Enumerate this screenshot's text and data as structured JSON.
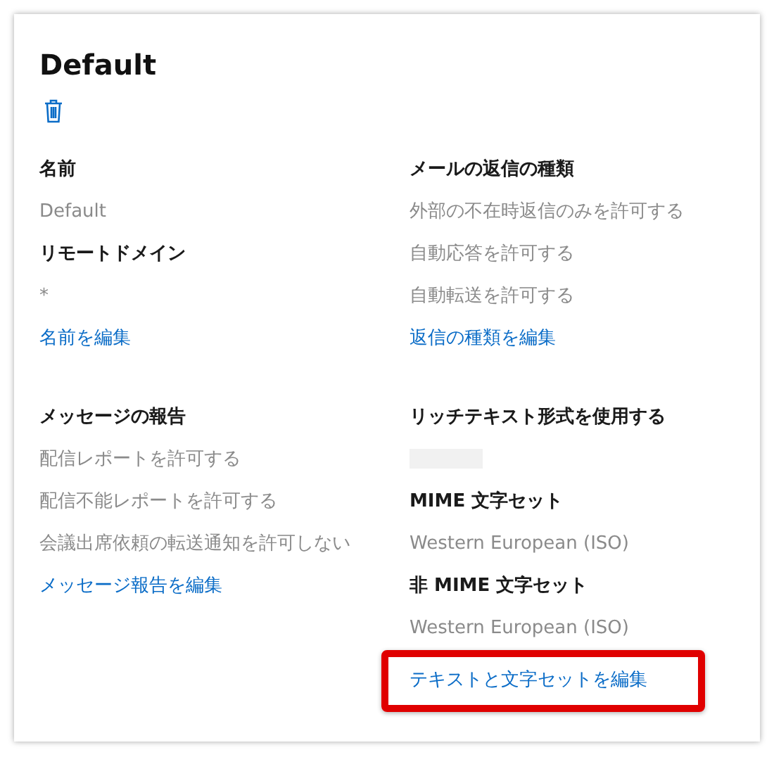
{
  "title": "Default",
  "sections": [
    {
      "columns": [
        {
          "items": [
            {
              "kind": "heading",
              "text": "名前"
            },
            {
              "kind": "value",
              "text": "Default"
            },
            {
              "kind": "heading",
              "text": "リモートドメイン"
            },
            {
              "kind": "value",
              "text": "*"
            },
            {
              "kind": "link",
              "text": "名前を編集",
              "highlighted": false
            }
          ]
        },
        {
          "items": [
            {
              "kind": "heading",
              "text": "メールの返信の種類"
            },
            {
              "kind": "value",
              "text": "外部の不在時返信のみを許可する"
            },
            {
              "kind": "value",
              "text": "自動応答を許可する"
            },
            {
              "kind": "value",
              "text": "自動転送を許可する"
            },
            {
              "kind": "link",
              "text": "返信の種類を編集",
              "highlighted": false
            }
          ]
        }
      ]
    },
    {
      "columns": [
        {
          "items": [
            {
              "kind": "heading",
              "text": "メッセージの報告"
            },
            {
              "kind": "value",
              "text": "配信レポートを許可する"
            },
            {
              "kind": "value",
              "text": "配信不能レポートを許可する"
            },
            {
              "kind": "value",
              "text": "会議出席依頼の転送通知を許可しない"
            },
            {
              "kind": "link",
              "text": "メッセージ報告を編集",
              "highlighted": false
            }
          ]
        },
        {
          "items": [
            {
              "kind": "heading",
              "text": "リッチテキスト形式を使用する"
            },
            {
              "kind": "redacted"
            },
            {
              "kind": "heading",
              "text": "MIME 文字セット"
            },
            {
              "kind": "value",
              "text": "Western European (ISO)"
            },
            {
              "kind": "heading",
              "text": "非 MIME 文字セット"
            },
            {
              "kind": "value",
              "text": "Western European (ISO)"
            },
            {
              "kind": "link",
              "text": "テキストと文字セットを編集",
              "highlighted": true
            }
          ]
        }
      ]
    }
  ]
}
